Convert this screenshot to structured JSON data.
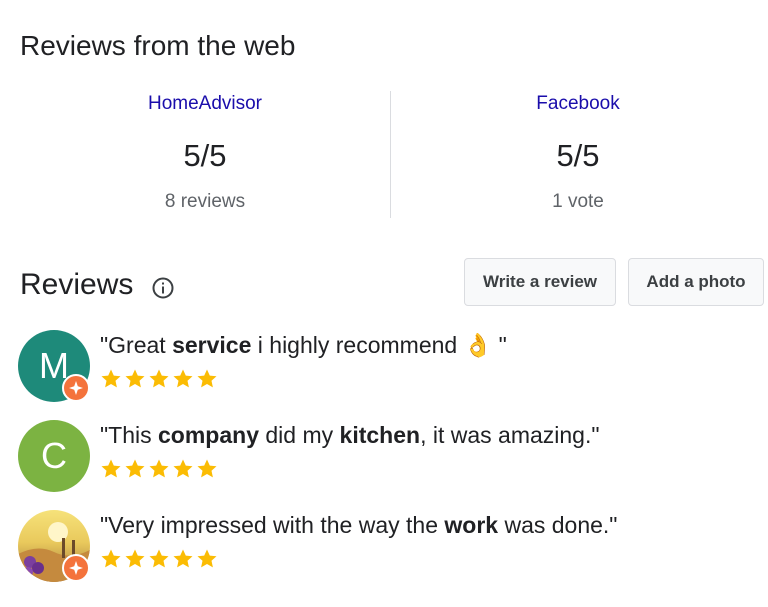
{
  "web_reviews": {
    "title": "Reviews from the web",
    "sources": [
      {
        "name": "HomeAdvisor",
        "score": "5/5",
        "count": "8 reviews"
      },
      {
        "name": "Facebook",
        "score": "5/5",
        "count": "1 vote"
      }
    ]
  },
  "reviews": {
    "title": "Reviews",
    "write_label": "Write a review",
    "photo_label": "Add a photo",
    "items": [
      {
        "avatar_letter": "M",
        "avatar_color": "#1e8a7a",
        "badge": true,
        "parts": [
          "\"Great ",
          "service",
          " i highly recommend ",
          "👌",
          " \""
        ],
        "rating": 5
      },
      {
        "avatar_letter": "C",
        "avatar_color": "#7cb342",
        "badge": false,
        "parts": [
          "\"This ",
          "company",
          " did my ",
          "kitchen",
          ", it was amazing.\""
        ],
        "rating": 5
      },
      {
        "avatar_letter": "",
        "avatar_color": "#e9c95c",
        "badge": true,
        "parts": [
          "\"Very impressed with the way the ",
          "work",
          " was done.\""
        ],
        "rating": 5
      }
    ]
  },
  "colors": {
    "link": "#1a0dab",
    "star": "#fbbc04",
    "badge": "#f4733c"
  }
}
